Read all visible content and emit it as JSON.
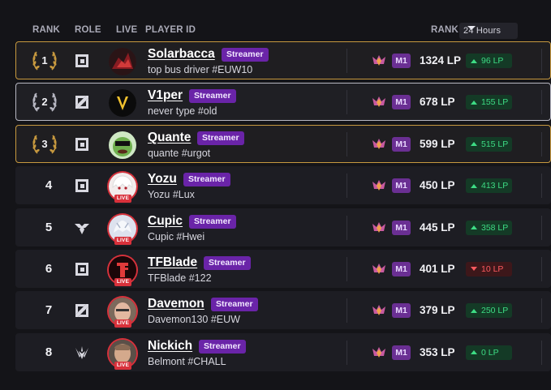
{
  "header": {
    "rank": "RANK",
    "role": "ROLE",
    "live": "LIVE",
    "player_id": "PLAYER ID",
    "rank_right": "RANK",
    "period": "24 Hours"
  },
  "colors": {
    "gold": "#c7993f",
    "silver": "#b7b7c2",
    "streamer_tag": "#6a24a8",
    "live": "#d8313b",
    "gain": "#3ddc84",
    "loss": "#ff5a5f"
  },
  "rows": [
    {
      "rank": "1",
      "role": "jungle-icon",
      "name": "Solarbacca",
      "tag": "Streamer",
      "subtitle": "top bus driver #EUW10",
      "live": false,
      "tier": "M1",
      "lp": "1324 LP",
      "delta": "96 LP",
      "delta_dir": "up"
    },
    {
      "rank": "2",
      "role": "top-icon",
      "name": "V1per",
      "tag": "Streamer",
      "subtitle": "never type #old",
      "live": false,
      "tier": "M1",
      "lp": "678 LP",
      "delta": "155 LP",
      "delta_dir": "up"
    },
    {
      "rank": "3",
      "role": "jungle-icon",
      "name": "Quante",
      "tag": "Streamer",
      "subtitle": "quante #urgot",
      "live": false,
      "tier": "M1",
      "lp": "599 LP",
      "delta": "515 LP",
      "delta_dir": "up"
    },
    {
      "rank": "4",
      "role": "jungle-icon",
      "name": "Yozu",
      "tag": "Streamer",
      "subtitle": "Yozu #Lux",
      "live": true,
      "tier": "M1",
      "lp": "450 LP",
      "delta": "413 LP",
      "delta_dir": "up"
    },
    {
      "rank": "5",
      "role": "support-icon",
      "name": "Cupic",
      "tag": "Streamer",
      "subtitle": "Cupic #Hwei",
      "live": true,
      "tier": "M1",
      "lp": "445 LP",
      "delta": "358 LP",
      "delta_dir": "up"
    },
    {
      "rank": "6",
      "role": "jungle-icon",
      "name": "TFBlade",
      "tag": "Streamer",
      "subtitle": "TFBlade #122",
      "live": true,
      "tier": "M1",
      "lp": "401 LP",
      "delta": "10 LP",
      "delta_dir": "down"
    },
    {
      "rank": "7",
      "role": "top-icon",
      "name": "Davemon",
      "tag": "Streamer",
      "subtitle": "Davemon130 #EUW",
      "live": true,
      "tier": "M1",
      "lp": "379 LP",
      "delta": "250 LP",
      "delta_dir": "up"
    },
    {
      "rank": "8",
      "role": "mid-icon",
      "name": "Nickich",
      "tag": "Streamer",
      "subtitle": "Belmont #CHALL",
      "live": true,
      "tier": "M1",
      "lp": "353 LP",
      "delta": "0 LP",
      "delta_dir": "up"
    }
  ],
  "live_label": "LIVE"
}
